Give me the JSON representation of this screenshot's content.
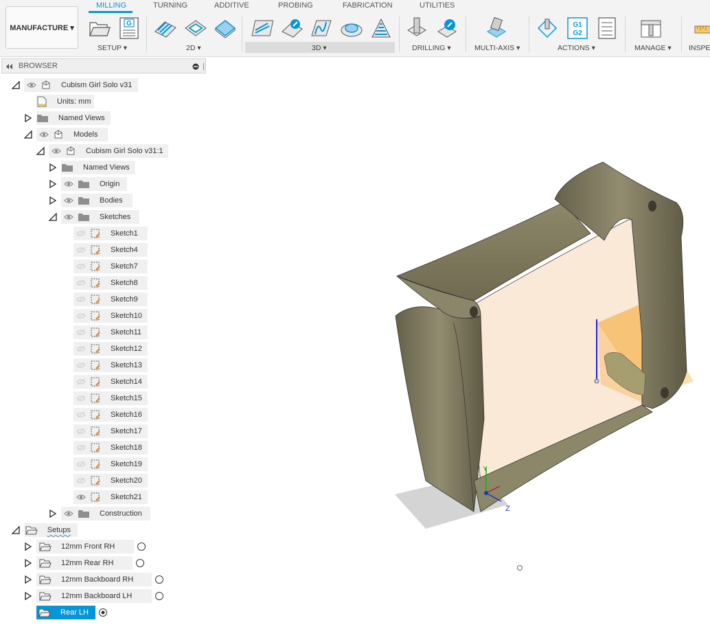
{
  "workspace": {
    "label": "MANUFACTURE ▾"
  },
  "tabs": [
    "MILLING",
    "TURNING",
    "ADDITIVE",
    "PROBING",
    "FABRICATION",
    "UTILITIES"
  ],
  "groups": [
    "SETUP ▾",
    "2D ▾",
    "3D ▾",
    "DRILLING ▾",
    "MULTI-AXIS ▾",
    "ACTIONS ▾",
    "MANAGE ▾",
    "INSPEC"
  ],
  "toolbar_icons": {
    "nc_program_letter": "G",
    "post_g1": "G1",
    "post_g2": "G2"
  },
  "browser": {
    "title": "BROWSER",
    "root": "Cubism Girl Solo v31",
    "units": "Units: mm",
    "named_views": "Named Views",
    "models": "Models",
    "component": "Cubism Girl Solo v31:1",
    "comp_named_views": "Named Views",
    "origin": "Origin",
    "bodies": "Bodies",
    "sketches": "Sketches",
    "sketch_items": [
      "Sketch1",
      "Sketch4",
      "Sketch7",
      "Sketch8",
      "Sketch9",
      "Sketch10",
      "Sketch11",
      "Sketch12",
      "Sketch13",
      "Sketch14",
      "Sketch15",
      "Sketch16",
      "Sketch17",
      "Sketch18",
      "Sketch19",
      "Sketch20",
      "Sketch21"
    ],
    "construction": "Construction",
    "setups": "Setups",
    "setup_items": [
      "12mm Front RH",
      "12mm Rear RH",
      "12mm Backboard RH",
      "12mm Backboard LH",
      "Rear LH"
    ]
  },
  "viewport": {
    "axis_y": "Y",
    "axis_z": "Z"
  },
  "colors": {
    "accent": "#0696d7",
    "model": "#7c7657",
    "selection": "#0696d7"
  }
}
